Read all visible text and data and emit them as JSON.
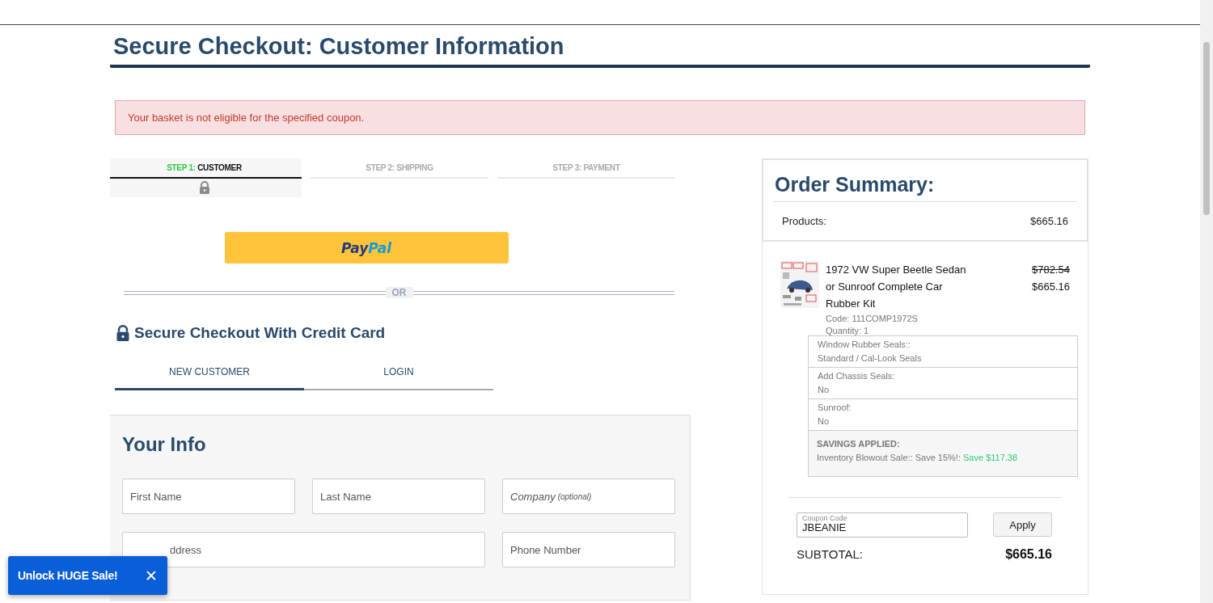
{
  "page_title": "Secure Checkout: Customer Information",
  "alert": "Your basket is not eligible for the specified coupon.",
  "steps": [
    {
      "prefix": "STEP 1:",
      "label": "CUSTOMER",
      "selected": true,
      "locked": true
    },
    {
      "prefix": "STEP 2:",
      "label": "SHIPPING",
      "selected": false,
      "locked": false
    },
    {
      "prefix": "STEP 3:",
      "label": "PAYMENT",
      "selected": false,
      "locked": false
    }
  ],
  "paypal": {
    "pay": "Pay",
    "pal": "Pal"
  },
  "divider": "OR",
  "credit_heading": "Secure Checkout With Credit Card",
  "customer_tabs": [
    {
      "label": "NEW CUSTOMER",
      "selected": true
    },
    {
      "label": "LOGIN",
      "selected": false
    }
  ],
  "info": {
    "title": "Your Info",
    "fields": [
      {
        "kind": "narrow",
        "placeholder": "First Name"
      },
      {
        "kind": "narrow",
        "placeholder": "Last Name"
      },
      {
        "kind": "narrow",
        "placeholder": "Company",
        "note": "(optional)"
      },
      {
        "kind": "wide",
        "placeholder": "ddress"
      },
      {
        "kind": "narrow",
        "placeholder": "Phone Number"
      }
    ]
  },
  "summary": {
    "title": "Order Summary:",
    "products_label": "Products:",
    "products_total": "$665.16",
    "item": {
      "name": "1972 VW Super Beetle Sedan or Sunroof Complete Car Rubber Kit",
      "old_price": "$782.54",
      "price": "$665.16",
      "code": "Code: 111COMP1972S",
      "quantity": "Quantity: 1",
      "options": [
        {
          "label": "Window Rubber Seals::",
          "value": "Standard / Cal-Look Seals"
        },
        {
          "label": "Add Chassis Seals:",
          "value": "No"
        },
        {
          "label": "Sunroof:",
          "value": "No"
        }
      ],
      "savings": {
        "title": "SAVINGS APPLIED:",
        "text": "Inventory Blowout Sale:: Save 15%!:",
        "amount": "Save $117.38"
      }
    },
    "coupon": {
      "label": "Coupon Code",
      "value": "JBEANIE",
      "button": "Apply"
    },
    "subtotal_label": "SUBTOTAL:",
    "subtotal": "$665.16"
  },
  "promo": {
    "text": "Unlock HUGE Sale!",
    "close": "✕"
  }
}
